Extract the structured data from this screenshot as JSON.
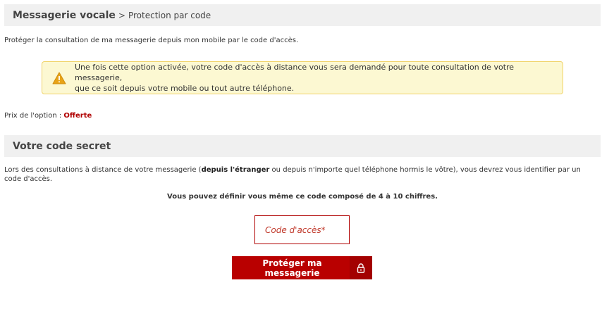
{
  "header": {
    "title": "Messagerie vocale",
    "separator": ">",
    "subtitle": "Protection par code"
  },
  "intro": "Protéger la consultation de ma messagerie depuis mon mobile par le code d'accès.",
  "alert": {
    "icon": "warning-triangle-icon",
    "line1": "Une fois cette option activée, votre code d'accès à distance vous sera demandé pour toute consultation de votre messagerie,",
    "line2": "que ce soit depuis votre mobile ou tout autre téléphone."
  },
  "price": {
    "label": "Prix de l'option : ",
    "value": "Offerte"
  },
  "section": {
    "title": "Votre code secret"
  },
  "description": {
    "part1": "Lors des consultations à distance de votre messagerie (",
    "bold": "depuis l'étranger",
    "part2": " ou depuis n'importe quel téléphone hormis le vôtre), vous devrez vous identifier par un code d'accès."
  },
  "hint": "Vous pouvez définir vous même ce code composé de 4 à 10 chiffres.",
  "code_input": {
    "placeholder": "Code d'accès*",
    "value": ""
  },
  "button": {
    "label": "Protéger ma messagerie",
    "icon": "lock-icon"
  },
  "colors": {
    "accent": "#b90000",
    "alert_bg": "#fcf8d2",
    "alert_border": "#f0d36a",
    "bar_bg": "#f0f0f0"
  }
}
